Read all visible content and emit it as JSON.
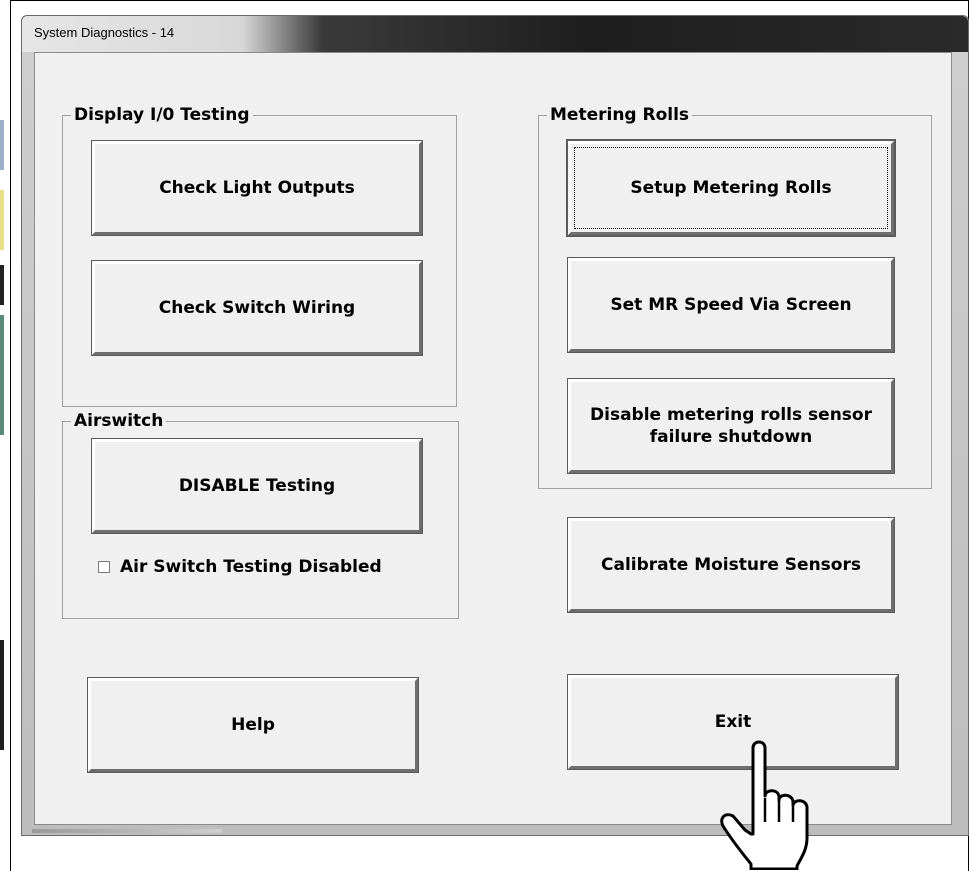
{
  "window": {
    "title": "System Diagnostics - 14"
  },
  "display_io": {
    "label": "Display I/0 Testing",
    "check_light_outputs": "Check Light Outputs",
    "check_switch_wiring": "Check Switch Wiring"
  },
  "airswitch": {
    "label": "Airswitch",
    "disable_testing": "DISABLE Testing",
    "checkbox_label": "Air Switch Testing Disabled",
    "checkbox_checked": false
  },
  "metering_rolls": {
    "label": "Metering Rolls",
    "setup": "Setup Metering Rolls",
    "set_speed": "Set MR Speed Via Screen",
    "disable_sensor_line1": "Disable metering rolls sensor",
    "disable_sensor_line2": "failure shutdown"
  },
  "calibrate_moisture": "Calibrate Moisture Sensors",
  "help": "Help",
  "exit": "Exit",
  "pointer_icon": "hand-pointer-icon",
  "colors": {
    "window_bg": "#f0f0f0",
    "title_dark": "#1e1e1e"
  }
}
